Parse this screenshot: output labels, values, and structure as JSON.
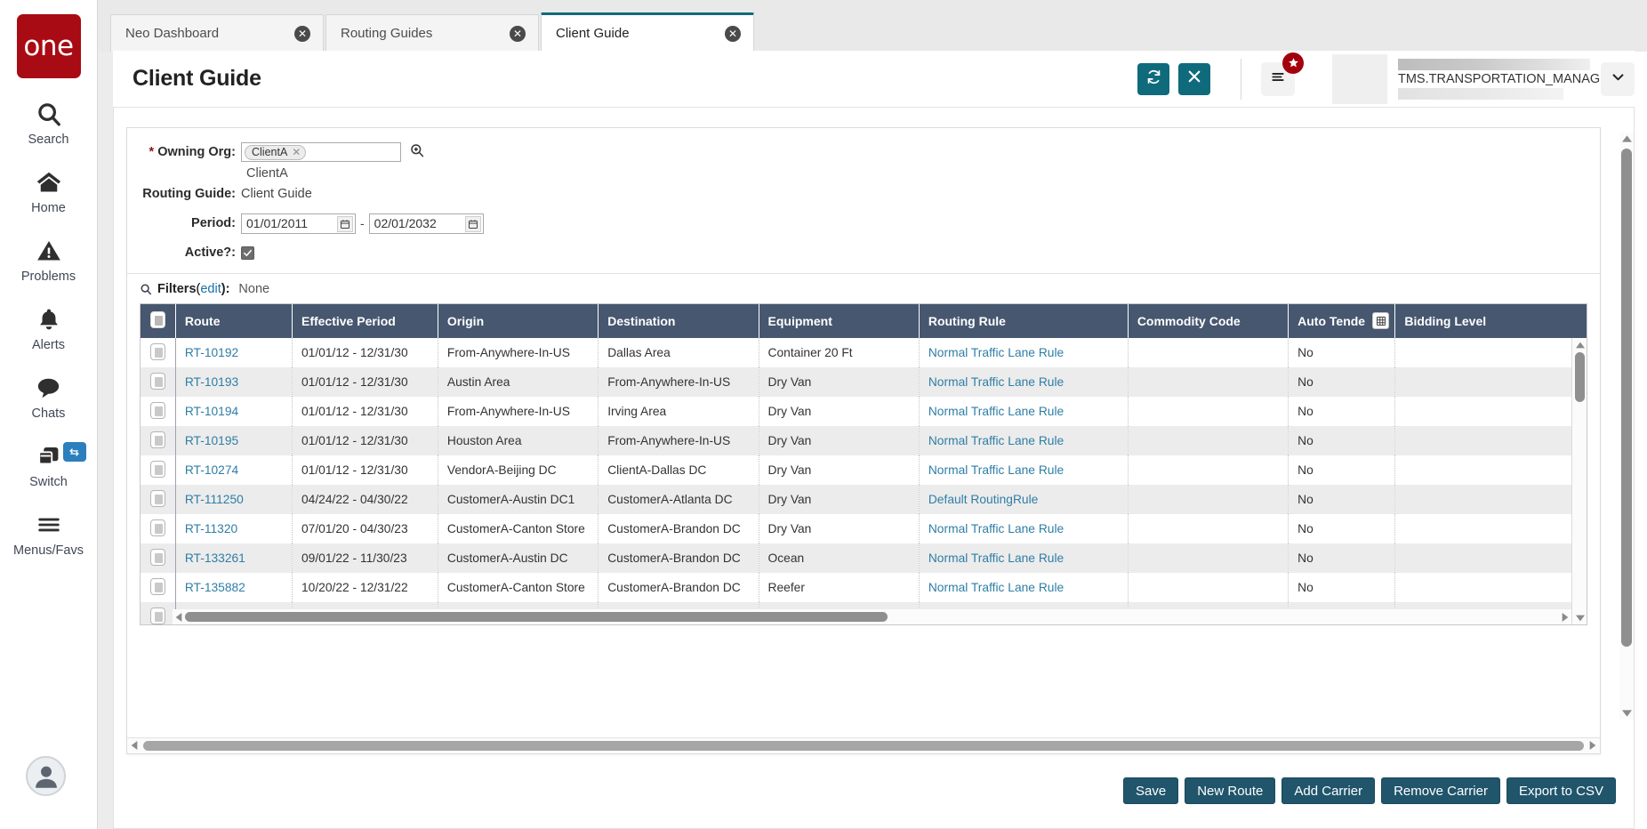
{
  "brand": {
    "logo_text": "one"
  },
  "sidebar": {
    "items": [
      {
        "label": "Search",
        "icon": "search-icon"
      },
      {
        "label": "Home",
        "icon": "home-icon"
      },
      {
        "label": "Problems",
        "icon": "warning-icon"
      },
      {
        "label": "Alerts",
        "icon": "bell-icon"
      },
      {
        "label": "Chats",
        "icon": "chat-bubble-icon"
      },
      {
        "label": "Switch",
        "icon": "windows-stack-icon",
        "badge_icon": "swap-arrows-icon"
      },
      {
        "label": "Menus/Favs",
        "icon": "hamburger-icon"
      }
    ]
  },
  "tabs": [
    {
      "label": "Neo Dashboard",
      "active": false,
      "close_icon": "close-circle-icon"
    },
    {
      "label": "Routing Guides",
      "active": false,
      "close_icon": "close-circle-icon"
    },
    {
      "label": "Client Guide",
      "active": true,
      "close_icon": "close-circle-icon"
    }
  ],
  "header": {
    "title": "Client Guide",
    "refresh_icon": "refresh-icon",
    "close_icon": "close-x-icon",
    "menu_icon": "list-menu-icon",
    "star_badge_icon": "star-icon",
    "caret_icon": "chevron-down-icon",
    "user_role": "TMS.TRANSPORTATION_MANAGER"
  },
  "criteria": {
    "owning_org_label": "Owning Org:",
    "owning_org_required": "*",
    "owning_org_token": "ClientA",
    "owning_org_token_remove_icon": "close-x-icon",
    "owning_org_search_icon": "search-plus-icon",
    "owning_org_suggestion": "ClientA",
    "routing_guide_label": "Routing Guide:",
    "routing_guide_value": "Client Guide",
    "period_label": "Period:",
    "period_from": "01/01/2011",
    "period_to": "02/01/2032",
    "period_separator": "-",
    "calendar_icon": "calendar-icon",
    "active_label": "Active?:",
    "active_checked": true,
    "check_icon": "check-icon"
  },
  "filters": {
    "icon": "search-icon",
    "label": "Filters",
    "edit_link": "edit",
    "paren_open": "(",
    "paren_close": "):",
    "value": "None"
  },
  "grid": {
    "select_all_icon": "checkbox-icon",
    "columns": [
      "Route",
      "Effective Period",
      "Origin",
      "Destination",
      "Equipment",
      "Routing Rule",
      "Commodity Code",
      "Auto Tende",
      "Bidding Level"
    ],
    "auto_tender_col_icon": "grid-config-icon",
    "rows": [
      {
        "route": "RT-10192",
        "effective_period": "01/01/12 - 12/31/30",
        "origin": "From-Anywhere-In-US",
        "destination": "Dallas Area",
        "equipment": "Container 20 Ft",
        "routing_rule": "Normal Traffic Lane Rule",
        "commodity_code": "",
        "auto_tender": "No",
        "bidding_level": ""
      },
      {
        "route": "RT-10193",
        "effective_period": "01/01/12 - 12/31/30",
        "origin": "Austin Area",
        "destination": "From-Anywhere-In-US",
        "equipment": "Dry Van",
        "routing_rule": "Normal Traffic Lane Rule",
        "commodity_code": "",
        "auto_tender": "No",
        "bidding_level": ""
      },
      {
        "route": "RT-10194",
        "effective_period": "01/01/12 - 12/31/30",
        "origin": "From-Anywhere-In-US",
        "destination": "Irving Area",
        "equipment": "Dry Van",
        "routing_rule": "Normal Traffic Lane Rule",
        "commodity_code": "",
        "auto_tender": "No",
        "bidding_level": ""
      },
      {
        "route": "RT-10195",
        "effective_period": "01/01/12 - 12/31/30",
        "origin": "Houston Area",
        "destination": "From-Anywhere-In-US",
        "equipment": "Dry Van",
        "routing_rule": "Normal Traffic Lane Rule",
        "commodity_code": "",
        "auto_tender": "No",
        "bidding_level": ""
      },
      {
        "route": "RT-10274",
        "effective_period": "01/01/12 - 12/31/30",
        "origin": "VendorA-Beijing DC",
        "destination": "ClientA-Dallas DC",
        "equipment": "Dry Van",
        "routing_rule": "Normal Traffic Lane Rule",
        "commodity_code": "",
        "auto_tender": "No",
        "bidding_level": ""
      },
      {
        "route": "RT-111250",
        "effective_period": "04/24/22 - 04/30/22",
        "origin": "CustomerA-Austin DC1",
        "destination": "CustomerA-Atlanta DC",
        "equipment": "Dry Van",
        "routing_rule": "Default RoutingRule",
        "commodity_code": "",
        "auto_tender": "No",
        "bidding_level": ""
      },
      {
        "route": "RT-11320",
        "effective_period": "07/01/20 - 04/30/23",
        "origin": "CustomerA-Canton Store",
        "destination": "CustomerA-Brandon DC",
        "equipment": "Dry Van",
        "routing_rule": "Normal Traffic Lane Rule",
        "commodity_code": "",
        "auto_tender": "No",
        "bidding_level": ""
      },
      {
        "route": "RT-133261",
        "effective_period": "09/01/22 - 11/30/23",
        "origin": "CustomerA-Austin DC",
        "destination": "CustomerA-Brandon DC",
        "equipment": "Ocean",
        "routing_rule": "Normal Traffic Lane Rule",
        "commodity_code": "",
        "auto_tender": "No",
        "bidding_level": ""
      },
      {
        "route": "RT-135882",
        "effective_period": "10/20/22 - 12/31/22",
        "origin": "CustomerA-Canton Store",
        "destination": "CustomerA-Brandon DC",
        "equipment": "Reefer",
        "routing_rule": "Normal Traffic Lane Rule",
        "commodity_code": "",
        "auto_tender": "No",
        "bidding_level": ""
      }
    ]
  },
  "footer": {
    "buttons": [
      {
        "label": "Save"
      },
      {
        "label": "New Route"
      },
      {
        "label": "Add Carrier"
      },
      {
        "label": "Remove Carrier"
      },
      {
        "label": "Export to CSV"
      }
    ]
  },
  "colors": {
    "brand_red": "#a80b13",
    "accent_teal": "#0f6b7c",
    "grid_header": "#46576f",
    "button_blue": "#20556b",
    "link_blue": "#2f7ea6"
  }
}
